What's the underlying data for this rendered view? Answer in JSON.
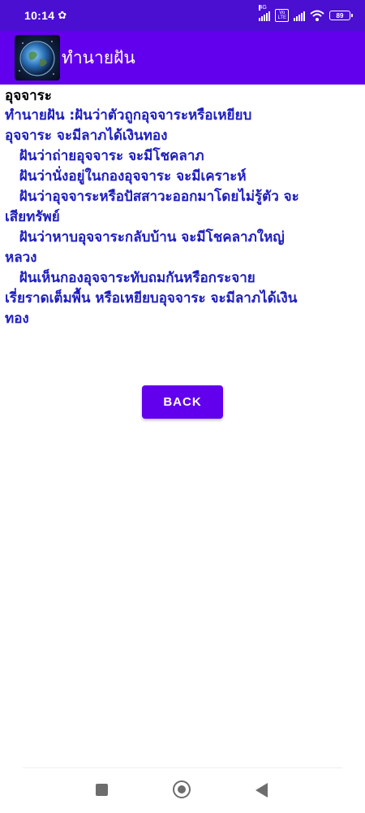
{
  "status_bar": {
    "time": "10:14",
    "network_type": "4G",
    "volte_top": "Vo",
    "volte_bottom": "LTE",
    "battery": "89",
    "icons": [
      "gear-icon",
      "signal-icon",
      "volte-icon",
      "signal-icon",
      "wifi-icon",
      "battery-icon"
    ]
  },
  "app_bar": {
    "title": "ทำนายฝัน",
    "logo_icon": "earth-logo",
    "color": "#6200ee"
  },
  "content": {
    "heading": "อุจจาระ",
    "lines": [
      "ทำนายฝัน :ฝันว่าตัวถูกอุจจาระหรือเหยียบ",
      "อุจจาระ จะมีลาภได้เงินทอง",
      "   ฝันว่าถ่ายอุจจาระ จะมีโชคลาภ",
      "   ฝันว่านั่งอยู่ในกองอุจจาระ จะมีเคราะห์",
      "   ฝันว่าอุจจาระหรือปัสสาวะออกมาโดยไม่รู้ตัว จะ",
      "เสียทรัพย์",
      "   ฝันว่าหาบอุจจาระกลับบ้าน จะมีโชคลาภใหญ่",
      "หลวง",
      "   ฝันเห็นกองอุจจาระทับถมกันหรือกระจาย",
      "เรี่ยราดเต็มพื้น หรือเหยียบอุจจาระ จะมีลาภได้เงิน",
      "ทอง"
    ],
    "text_color": "#1d1dc0"
  },
  "back_button": {
    "label": "BACK"
  },
  "nav_bar": {
    "icons": [
      "recents-icon",
      "home-icon",
      "back-icon"
    ]
  }
}
